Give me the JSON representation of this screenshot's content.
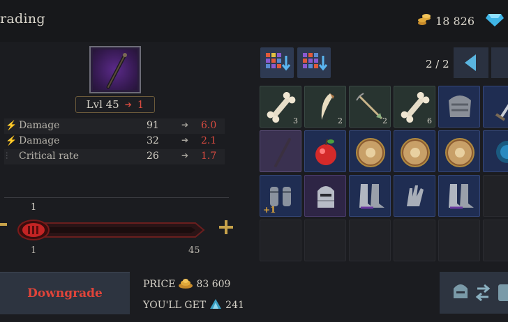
{
  "header": {
    "title": "rading",
    "coins": "18 826"
  },
  "item": {
    "level": "Lvl 45",
    "target_level": "1"
  },
  "stats": [
    {
      "icon": "damage-icon",
      "label": "Damage",
      "base": "91",
      "new": "6.0"
    },
    {
      "icon": "damage-icon",
      "label": "Damage",
      "base": "32",
      "new": "2.1"
    },
    {
      "icon": "critical-icon",
      "label": "Critical rate",
      "base": "26",
      "new": "1.7"
    }
  ],
  "slider": {
    "current": "1",
    "min": "1",
    "max": "45",
    "value_fraction": 0.0
  },
  "action": {
    "button_label": "Downgrade",
    "price_label": "PRICE",
    "price_value": "83 609",
    "get_label": "YOU'LL GET",
    "get_value": "241"
  },
  "inventory": {
    "page": "2 / 2",
    "rows": [
      [
        {
          "kind": "green",
          "icon": "bone-icon",
          "count": "3"
        },
        {
          "kind": "green",
          "icon": "fang-icon",
          "count": "2"
        },
        {
          "kind": "green",
          "icon": "arrow-icon",
          "count": "2"
        },
        {
          "kind": "green",
          "icon": "bone-icon",
          "count": "6"
        },
        {
          "kind": "blue",
          "icon": "pauldron-icon",
          "count": ""
        },
        {
          "kind": "blue",
          "icon": "sword-icon",
          "count": ""
        }
      ],
      [
        {
          "kind": "selected",
          "icon": "staff-icon",
          "count": ""
        },
        {
          "kind": "blue",
          "icon": "apple-icon",
          "count": ""
        },
        {
          "kind": "blue",
          "icon": "shield-icon",
          "count": ""
        },
        {
          "kind": "blue",
          "icon": "shield-icon",
          "count": ""
        },
        {
          "kind": "blue",
          "icon": "shield-icon",
          "count": ""
        },
        {
          "kind": "blue",
          "icon": "orb-icon",
          "count": ""
        }
      ],
      [
        {
          "kind": "blue",
          "icon": "bracers-icon",
          "count": "",
          "bonus": "+1"
        },
        {
          "kind": "purple",
          "icon": "helmet-icon",
          "count": ""
        },
        {
          "kind": "blue",
          "icon": "boots-icon",
          "count": ""
        },
        {
          "kind": "blue",
          "icon": "gauntlet-icon",
          "count": ""
        },
        {
          "kind": "blue",
          "icon": "boots-icon",
          "count": ""
        },
        {
          "kind": "empty",
          "icon": "",
          "count": ""
        }
      ],
      [
        {
          "kind": "empty",
          "icon": "",
          "count": ""
        },
        {
          "kind": "empty",
          "icon": "",
          "count": ""
        },
        {
          "kind": "empty",
          "icon": "",
          "count": ""
        },
        {
          "kind": "empty",
          "icon": "",
          "count": ""
        },
        {
          "kind": "empty",
          "icon": "",
          "count": ""
        },
        {
          "kind": "empty",
          "icon": "",
          "count": ""
        }
      ]
    ]
  },
  "colors": {
    "accent_gold": "#c7a24a",
    "value_red": "#d94b40",
    "button_red": "#e0443a"
  }
}
